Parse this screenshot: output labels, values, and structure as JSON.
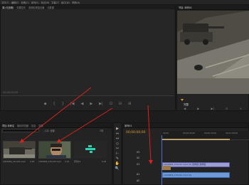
{
  "menu": [
    "文件(F)",
    "编辑(E)",
    "剪辑(C)",
    "序列(S)",
    "标记(M)",
    "字幕(T)",
    "窗口(W)",
    "帮助(H)"
  ],
  "source_monitor": {
    "tabs": [
      "源:(无剪辑)",
      "效果控件",
      "音频剪辑混合器",
      "元数据"
    ],
    "timecode": "00;00;00;00",
    "controls": [
      "◆",
      "{",
      "}",
      "|◀",
      "◀",
      "▶",
      "▶|",
      "⊡",
      "⊟",
      "⊞"
    ]
  },
  "program_monitor": {
    "tab": "节目: 序列01",
    "dropdown": "完整",
    "controls": [
      "◀",
      "▶",
      "▶|",
      "⊡",
      "+"
    ]
  },
  "project": {
    "tabs": [
      "项目:未命名",
      "媒体浏览器",
      "信息",
      "效果"
    ],
    "search_placeholder": "",
    "filter_label": "入口: 全部",
    "count": "3项",
    "items": [
      {
        "label": "1024609_151121.mp4",
        "duration": "4:23",
        "thumb": "tank"
      },
      {
        "label": "1024609_151122.mp4",
        "duration": "2:12",
        "thumb": "man"
      },
      {
        "label": "序列01",
        "duration": "4:23",
        "thumb": "sequence"
      }
    ]
  },
  "timeline": {
    "tab": "序列01",
    "timecode": "00;00;00;00",
    "ruler_ticks": [
      "00;00",
      "00;00;00;00",
      "00;00;30;00",
      "00;01;00;00"
    ],
    "tracks": [
      {
        "name": "V3",
        "kind": "video"
      },
      {
        "name": "V2",
        "kind": "video"
      },
      {
        "name": "V1",
        "kind": "video"
      },
      {
        "name": "A1",
        "kind": "audio"
      },
      {
        "name": "A2",
        "kind": "audio"
      }
    ],
    "clips": {
      "video": "1024609_151121.mp4 [V] 透明度:透明度",
      "audio": "1024609_151121.mp4 [A]"
    }
  },
  "tools": [
    "▶",
    "⇔",
    "↔",
    "◇",
    "✂",
    "⊢",
    "✎",
    "✋",
    "🔍"
  ],
  "colors": {
    "accent": "#e2a12a",
    "video_clip": "#9b9fd6",
    "audio_clip": "#6f9bd9",
    "annotation": "#d8241c"
  }
}
